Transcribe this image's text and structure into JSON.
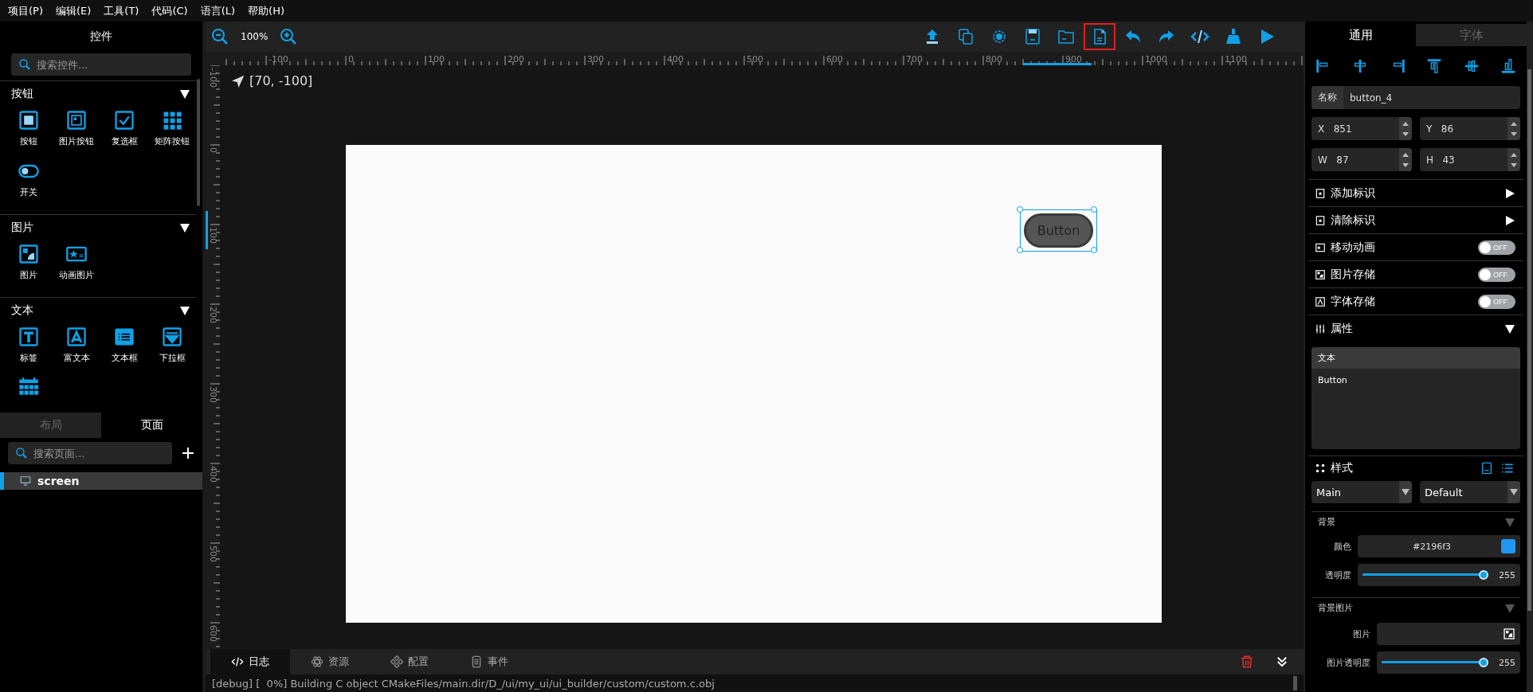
{
  "menu": [
    "项目(P)",
    "编辑(E)",
    "工具(T)",
    "代码(C)",
    "语言(L)",
    "帮助(H)"
  ],
  "widgets": {
    "title": "控件",
    "search_placeholder": "搜索控件...",
    "groups": [
      {
        "title": "按钮",
        "expanded": true,
        "items": [
          {
            "label": "按钮"
          },
          {
            "label": "图片按钮"
          },
          {
            "label": "复选框"
          },
          {
            "label": "矩阵按钮"
          },
          {
            "label": "开关"
          }
        ]
      },
      {
        "title": "图片",
        "expanded": true,
        "items": [
          {
            "label": "图片"
          },
          {
            "label": "动画图片"
          }
        ]
      },
      {
        "title": "文本",
        "expanded": true,
        "items": [
          {
            "label": "标签"
          },
          {
            "label": "富文本"
          },
          {
            "label": "文本框"
          },
          {
            "label": "下拉框"
          }
        ]
      }
    ]
  },
  "left_tabs": [
    {
      "label": "布局",
      "selected": false
    },
    {
      "label": "页面",
      "selected": true
    }
  ],
  "pages": {
    "search_placeholder": "搜索页面...",
    "items": [
      {
        "label": "screen",
        "selected": true
      }
    ]
  },
  "toolbar": {
    "zoom": "100%",
    "tools": [
      {
        "highlighted": false
      },
      {
        "highlighted": false
      },
      {
        "highlighted": false
      },
      {
        "highlighted": false
      },
      {
        "highlighted": false
      },
      {
        "highlighted": true
      },
      {
        "highlighted": false
      },
      {
        "highlighted": false
      },
      {
        "highlighted": false
      },
      {
        "highlighted": false
      },
      {
        "highlighted": false
      }
    ]
  },
  "cursor_position": "[70, -100]",
  "rulers": {
    "horizontal": [
      "-100",
      "0",
      "100",
      "200",
      "300",
      "400",
      "500",
      "600",
      "700",
      "800",
      "900",
      "1000",
      "1100"
    ],
    "vertical": [
      "-100",
      "0",
      "100",
      "200",
      "300",
      "400",
      "500",
      "600"
    ]
  },
  "canvas": {
    "widget": {
      "text": "Button",
      "selected": true
    }
  },
  "bottom_tabs": [
    {
      "label": "日志",
      "selected": true
    },
    {
      "label": "资源",
      "selected": false
    },
    {
      "label": "配置",
      "selected": false
    },
    {
      "label": "事件",
      "selected": false
    }
  ],
  "log": "[debug] [  0%] Building C object CMakeFiles/main.dir/D_/ui/my_ui/ui_builder/custom/custom.c.obj",
  "inspector": {
    "tabs": [
      {
        "label": "通用",
        "selected": true
      },
      {
        "label": "字体",
        "selected": false
      }
    ],
    "name": {
      "label": "名称",
      "value": "button_4"
    },
    "geometry": [
      {
        "label": "X",
        "value": "851"
      },
      {
        "label": "Y",
        "value": "86"
      },
      {
        "label": "W",
        "value": "87"
      },
      {
        "label": "H",
        "value": "43"
      }
    ],
    "rows": [
      {
        "kind": "submenu",
        "label": "添加标识",
        "expanded": false
      },
      {
        "kind": "submenu",
        "label": "清除标识",
        "expanded": false
      },
      {
        "kind": "toggle",
        "label": "移动动画",
        "on": false,
        "state_text": "OFF"
      },
      {
        "kind": "toggle",
        "label": "图片存储",
        "on": false,
        "state_text": "OFF"
      },
      {
        "kind": "toggle",
        "label": "字体存储",
        "on": false,
        "state_text": "OFF"
      },
      {
        "kind": "section",
        "label": "属性",
        "expanded": true
      }
    ],
    "text_property": {
      "label": "文本",
      "value": "Button"
    },
    "style": {
      "title": "样式",
      "selects": [
        "Main",
        "Default"
      ]
    },
    "background": {
      "title": "背景",
      "expanded": true,
      "color": {
        "label": "颜色",
        "value": "#2196f3",
        "color": "#2196f3"
      },
      "opacity": {
        "label": "透明度",
        "level": 1,
        "reading": "255"
      }
    },
    "background_image": {
      "title": "背景图片",
      "expanded": true,
      "image": {
        "label": "图片"
      },
      "opacity": {
        "label": "图片透明度",
        "level": 1,
        "reading": "255"
      }
    }
  }
}
